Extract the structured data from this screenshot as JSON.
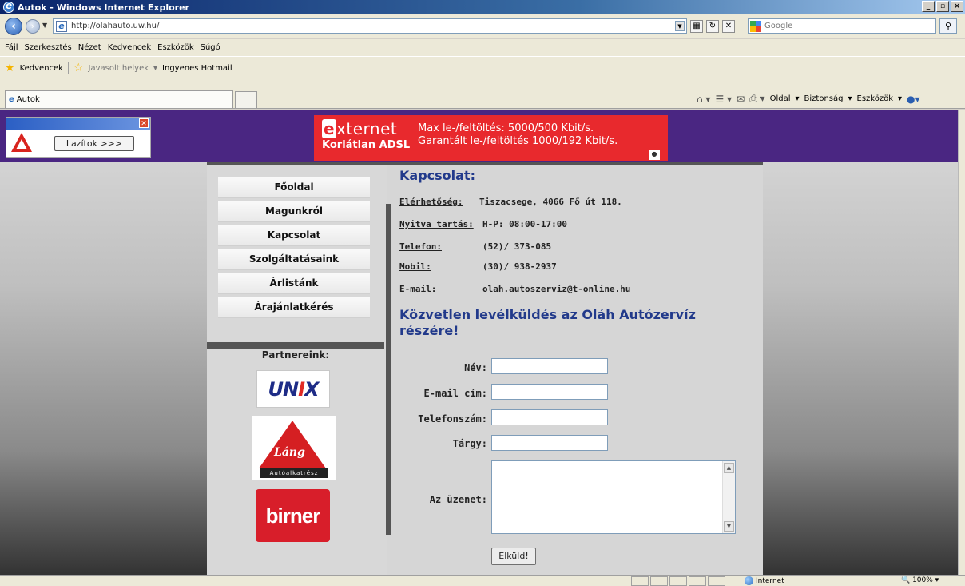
{
  "window": {
    "title": "Autok - Windows Internet Explorer"
  },
  "address": {
    "url": "http://olahauto.uw.hu/",
    "search_placeholder": "Google"
  },
  "menu": [
    "Fájl",
    "Szerkesztés",
    "Nézet",
    "Kedvencek",
    "Eszközök",
    "Súgó"
  ],
  "favorites": {
    "label": "Kedvencek",
    "suggested": "Javasolt helyek",
    "hotmail": "Ingyenes Hotmail"
  },
  "tab": {
    "title": "Autok"
  },
  "commandbar": [
    "Oldal",
    "Biztonság",
    "Eszközök"
  ],
  "ad": {
    "lazitok_button": "Lazítok >>>",
    "banner_brand": "xternet",
    "banner_brand_e": "e",
    "banner_sub": "Korlátlan ADSL",
    "banner_line1": "Max le-/feltöltés: 5000/500 Kbit/s.",
    "banner_line2": "Garantált le-/feltöltés 1000/192 Kbit/s."
  },
  "nav": [
    "Főoldal",
    "Magunkról",
    "Kapcsolat",
    "Szolgáltatásaink",
    "Árlistánk",
    "Árajánlatkérés"
  ],
  "partners": {
    "title": "Partnereink:",
    "unix_a": "UN",
    "unix_b": "I",
    "unix_c": "X",
    "lang": "Láng",
    "lang_sub": "Autóalkatrész",
    "birner": "birner"
  },
  "contact": {
    "title": "Kapcsolat:",
    "rows": [
      {
        "label": "Elérhetőség:",
        "value": "Tiszacsege, 4066 Fő út 118."
      },
      {
        "label": "Nyitva tartás:",
        "value": "H-P: 08:00-17:00"
      },
      {
        "label": "Telefon:",
        "value": "(52)/ 373-085"
      },
      {
        "label": "Mobil:",
        "value": "(30)/ 938-2937"
      },
      {
        "label": "E-mail:",
        "value": "olah.autoszerviz@t-online.hu"
      }
    ]
  },
  "form": {
    "heading": "Közvetlen levélküldés az Oláh Autózervíz részére!",
    "name_label": "Név:",
    "email_label": "E-mail cím:",
    "phone_label": "Telefonszám:",
    "subject_label": "Tárgy:",
    "message_label": "Az üzenet:",
    "submit": "Elküld!"
  },
  "status": {
    "zone": "Internet",
    "zoom": "100%"
  }
}
